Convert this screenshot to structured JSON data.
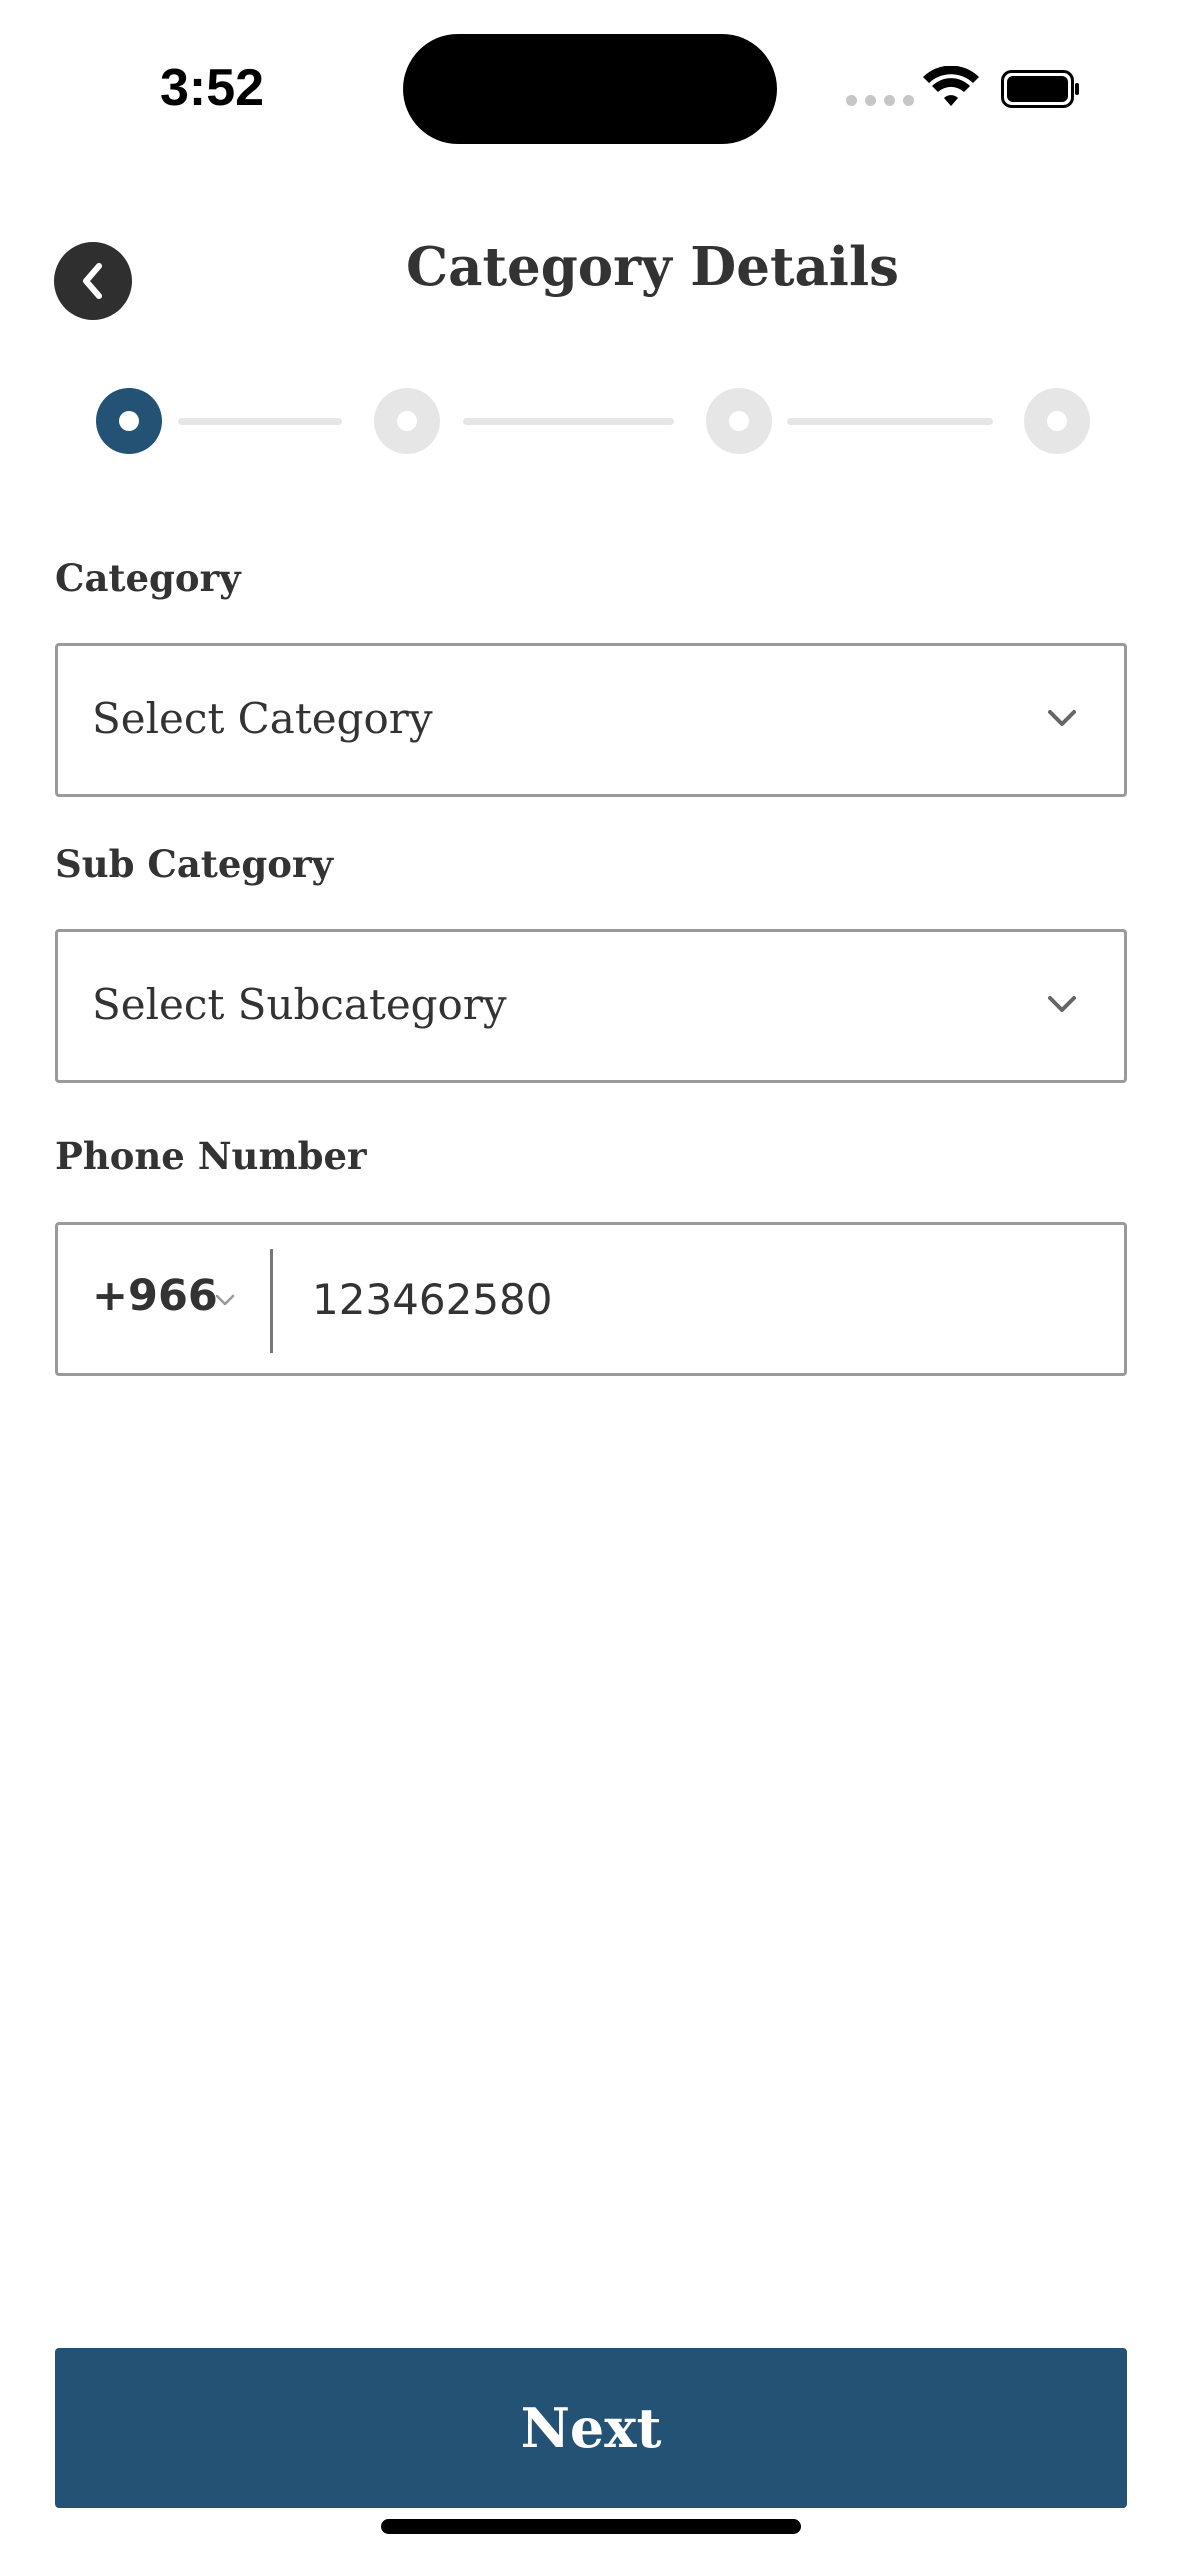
{
  "status_bar": {
    "time": "3:52",
    "icons": [
      "signal-icon",
      "wifi-icon",
      "battery-icon"
    ]
  },
  "header": {
    "title": "Category Details",
    "back_icon": "chevron-left-icon"
  },
  "stepper": {
    "total_steps": 4,
    "current_step": 1,
    "active_color": "#235274",
    "inactive_color": "#e6e6e6"
  },
  "form": {
    "category": {
      "label": "Category",
      "placeholder": "Select Category"
    },
    "sub_category": {
      "label": "Sub Category",
      "placeholder": "Select Subcategory"
    },
    "phone": {
      "label": "Phone Number",
      "country_code": "+966",
      "value": "123462580"
    }
  },
  "footer": {
    "next_label": "Next",
    "button_color": "#235274"
  }
}
